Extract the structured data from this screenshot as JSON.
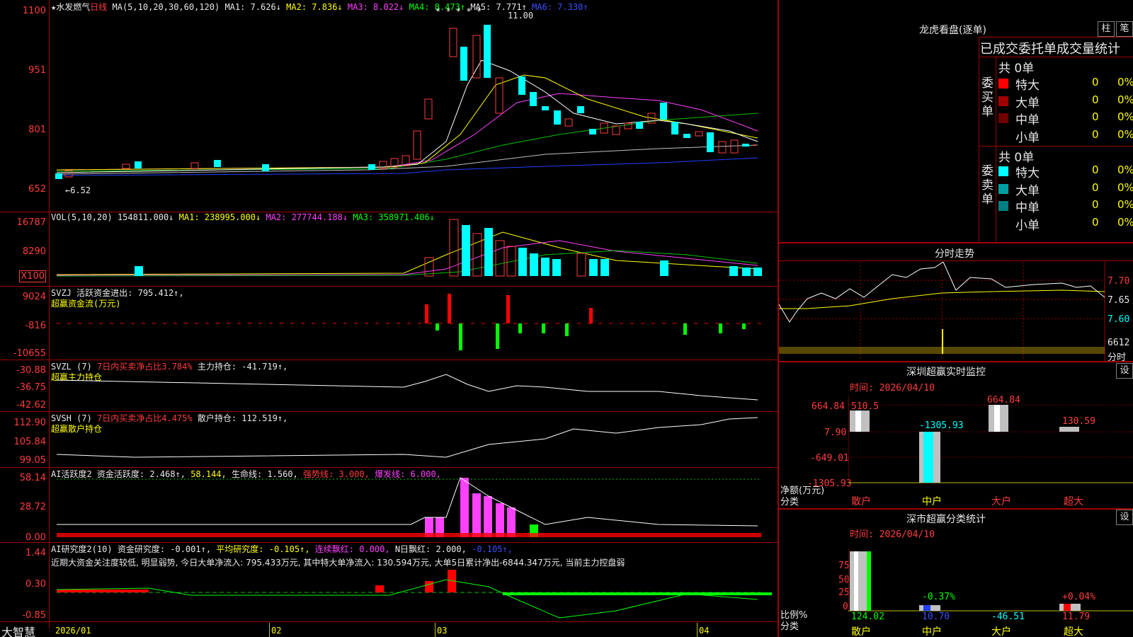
{
  "main": {
    "stock_name": "水发燃气",
    "period": "日线",
    "ma_label": "MA(5,10,20,30,60,120)",
    "ma1": "MA1: 7.626↓",
    "ma2": "MA2: 7.836↓",
    "ma3": "MA3: 8.022↓",
    "ma4": "MA4: 8.473↑",
    "ma5": "MA5: 7.771↑",
    "ma6": "MA6: 7.330↑",
    "y_ticks": [
      "1100",
      "951",
      "801",
      "652"
    ],
    "high_label": "11.00",
    "low_label": "←6.52"
  },
  "volume": {
    "label": "VOL(5,10,20)",
    "value": "154811.000↓",
    "ma1": "MA1: 238995.000↓",
    "ma2": "MA2: 277744.188↓",
    "ma3": "MA3: 358971.406↓",
    "y_ticks": [
      "16787",
      "8290",
      "X100"
    ]
  },
  "svzj": {
    "label": "SVZJ",
    "title": "活跃资金进出: 795.412↑,",
    "sub": "超赢资金流(万元)",
    "y_ticks": [
      "9024",
      "-816",
      "-10655"
    ]
  },
  "svzl": {
    "label": "SVZL (7)",
    "ratio": "7日内买卖净占比3.784%",
    "hold": "主力持仓: -41.719↑,",
    "sub": "超赢主力持仓",
    "y_ticks": [
      "-30.88",
      "-36.75",
      "-42.62"
    ]
  },
  "svsh": {
    "label": "SVSH (7)",
    "ratio": "7日内买卖净占比4.475%",
    "hold": "散户持仓: 112.519↑,",
    "sub": "超赢散户持仓",
    "y_ticks": [
      "112.90",
      "105.84",
      "99.05"
    ]
  },
  "ai_active": {
    "label": "AI活跃度2",
    "a": "资金活跃度: 2.468↑,",
    "b": "58.144,",
    "c": "生命线: 1.560,",
    "d": "强势线: 3.000,",
    "e": "爆发线: 6.000,",
    "y_ticks": [
      "58.14",
      "28.72",
      "0.00"
    ]
  },
  "ai_research": {
    "label": "AI研究度2(10)",
    "a": "资金研究度: -0.001↑,",
    "b": "平均研究度: -0.105↑,",
    "c": "连续飘红: 0.000,",
    "d": "N日飘红: 2.000,",
    "e": "-0.105↑,",
    "comment": "近期大资金关注度较低, 明显弱势, 今日大单净流入: 795.433万元, 其中特大单净流入: 130.594万元, 大单5日累计净出-6844.347万元, 当前主力控盘弱",
    "y_ticks": [
      "1.44",
      "0.30",
      "-0.85"
    ]
  },
  "footer": {
    "brand": "大智慧",
    "months": [
      "2026/01",
      "02",
      "03",
      "04"
    ]
  },
  "right": {
    "dragon_title": "龙虎看盘(逐单)",
    "btn_col": "柱",
    "btn_bi": "笔",
    "order_header": "已成交委托单成交量统计",
    "buy_label": "委买单",
    "sell_label": "委卖单",
    "buy_total": "共 0单",
    "sell_total": "共 0单",
    "buy_rows": [
      {
        "name": "特大",
        "count": "0",
        "pct": "0%",
        "color": "#ff0000"
      },
      {
        "name": "大单",
        "count": "0",
        "pct": "0%",
        "color": "#a00000"
      },
      {
        "name": "中单",
        "count": "0",
        "pct": "0%",
        "color": "#700000"
      },
      {
        "name": "小单",
        "count": "0",
        "pct": "0%",
        "color": ""
      }
    ],
    "sell_rows": [
      {
        "name": "特大",
        "count": "0",
        "pct": "0%",
        "color": "#00ffff"
      },
      {
        "name": "大单",
        "count": "0",
        "pct": "0%",
        "color": "#00a0a0"
      },
      {
        "name": "中单",
        "count": "0",
        "pct": "0%",
        "color": "#008080"
      },
      {
        "name": "小单",
        "count": "0",
        "pct": "0%",
        "color": ""
      }
    ],
    "intraday_title": "分时走势",
    "intraday_y": [
      "7.70",
      "7.65",
      "7.60"
    ],
    "intraday_vol": "6612",
    "intraday_vol_unit": "分时",
    "sz_monitor_title": "深圳超赢实时监控",
    "sz_btn": "设",
    "sz_time": "时间: 2026/04/10",
    "sz_y": [
      "664.84",
      "7.90",
      "-649.01",
      "-1305.93"
    ],
    "sz_unit": "净额(万元)",
    "sz_unit2": "分类",
    "sz_bars": [
      {
        "cat": "散户",
        "value": "510.5"
      },
      {
        "cat": "中户",
        "value": "-1305.93"
      },
      {
        "cat": "大户",
        "value": "664.84"
      },
      {
        "cat": "超大",
        "value": "130.59"
      }
    ],
    "sz_cls_title": "深市超赢分类统计",
    "sz_cls_btn": "设",
    "sz_cls_time": "时间: 2026/04/10",
    "sz_cls_y": [
      "75",
      "50",
      "25",
      "0"
    ],
    "sz_cls_unit": "比例%",
    "sz_cls_unit2": "分类",
    "sz_cls_bars": [
      {
        "cat": "散户",
        "pct_label": "",
        "value": "124.02"
      },
      {
        "cat": "中户",
        "pct_label": "-0.37%",
        "value": "10.70"
      },
      {
        "cat": "大户",
        "pct_label": "",
        "value": "-46.51"
      },
      {
        "cat": "超大",
        "pct_label": "+0.04%",
        "value": "11.79"
      }
    ]
  }
}
